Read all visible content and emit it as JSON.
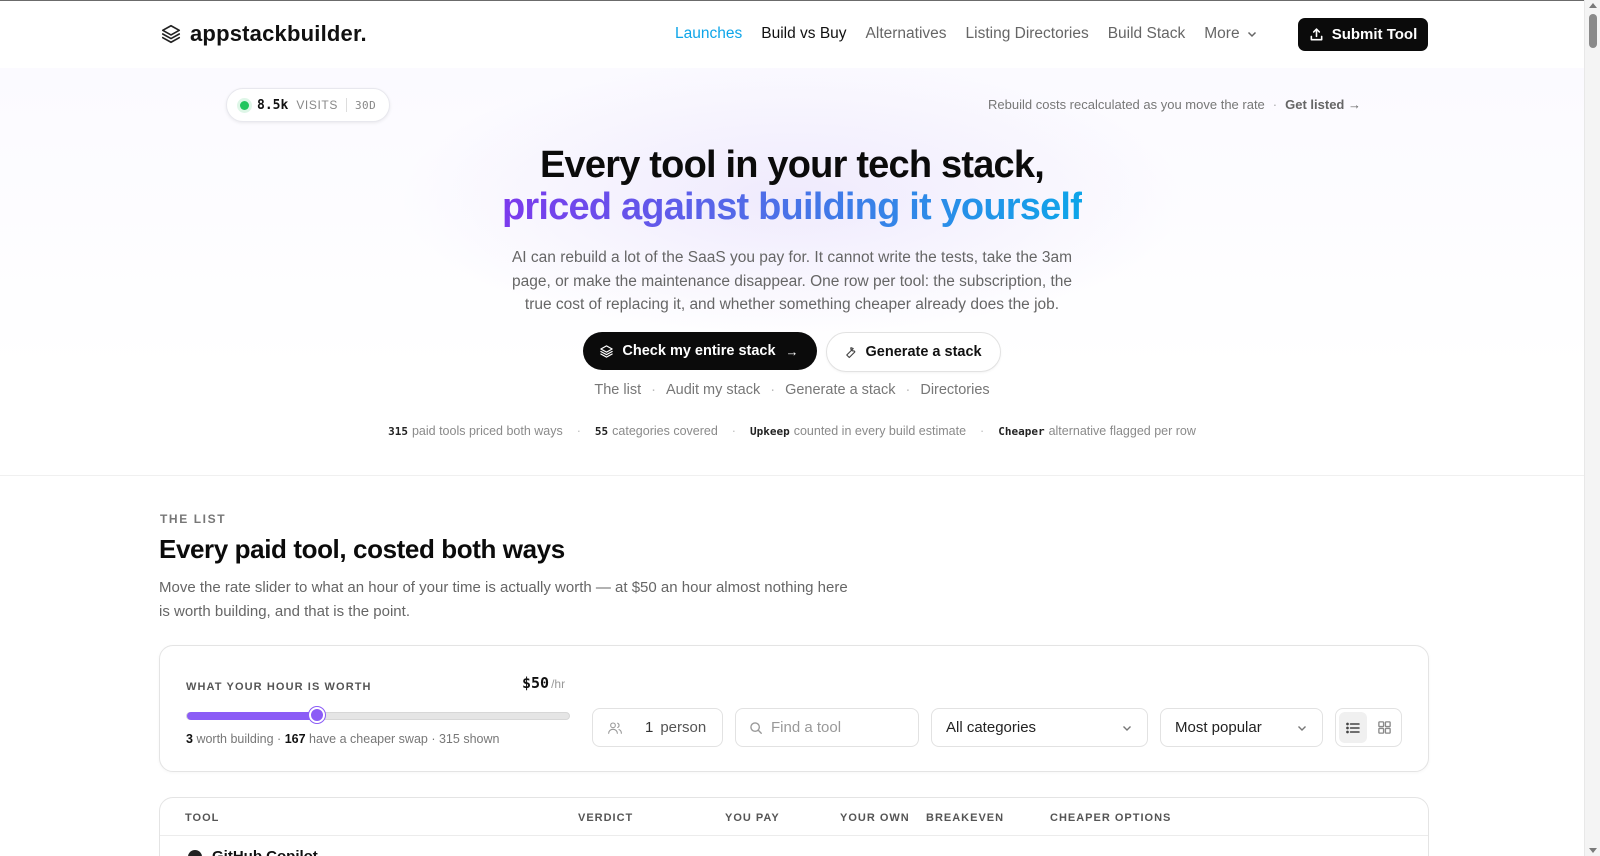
{
  "header": {
    "logo_text": "appstackbuilder.",
    "nav": [
      {
        "label": "Launches",
        "state": "active"
      },
      {
        "label": "Build vs Buy",
        "state": "dark"
      },
      {
        "label": "Alternatives",
        "state": "normal"
      },
      {
        "label": "Listing Directories",
        "state": "normal"
      },
      {
        "label": "Build Stack",
        "state": "normal"
      },
      {
        "label": "More",
        "state": "normal"
      }
    ],
    "submit_label": "Submit Tool"
  },
  "hero": {
    "visits_count": "8.5k",
    "visits_label": "VISITS",
    "visits_period": "30D",
    "rebuild_note": "Rebuild costs recalculated as you move the rate",
    "get_listed": "Get listed →",
    "headline_line1": "Every tool in your tech stack,",
    "headline_line2": "priced against building it yourself",
    "subcopy": "AI can rebuild a lot of the SaaS you pay for. It cannot write the tests, take the 3am page, or make the maintenance disappear. One row per tool: the subscription, the true cost of replacing it, and whether something cheaper already does the job.",
    "cta_primary": "Check my entire stack",
    "cta_secondary": "Generate a stack",
    "quick_links": [
      "The list",
      "Audit my stack",
      "Generate a stack",
      "Directories"
    ],
    "stats": [
      {
        "value": "315",
        "text": "paid tools priced both ways"
      },
      {
        "value": "55",
        "text": "categories covered"
      },
      {
        "value": "Upkeep",
        "text": "counted in every build estimate"
      },
      {
        "value": "Cheaper",
        "text": "alternative flagged per row"
      }
    ]
  },
  "list": {
    "eyebrow": "THE LIST",
    "title": "Every paid tool, costed both ways",
    "description": "Move the rate slider to what an hour of your time is actually worth — at $50 an hour almost nothing here is worth building, and that is the point."
  },
  "filters": {
    "rate_label": "WHAT YOUR HOUR IS WORTH",
    "rate_value": "$50",
    "rate_unit": "/hr",
    "slider_fraction": 0.34,
    "worth_building": "3",
    "worth_building_text": "worth building",
    "cheaper_swap": "167",
    "cheaper_swap_text": "have a cheaper swap",
    "shown_text": "315 shown",
    "people_count": "1",
    "people_label": "person",
    "search_placeholder": "Find a tool",
    "category_selected": "All categories",
    "sort_selected": "Most popular"
  },
  "table": {
    "columns": [
      "TOOL",
      "VERDICT",
      "YOU PAY",
      "YOUR OWN",
      "BREAKEVEN",
      "CHEAPER OPTIONS"
    ],
    "first_row_tool": "GitHub Copilot"
  },
  "colors": {
    "accent_nav": "#0ea5e9",
    "slider": "#8b5cf6",
    "status_dot": "#22c55e"
  }
}
